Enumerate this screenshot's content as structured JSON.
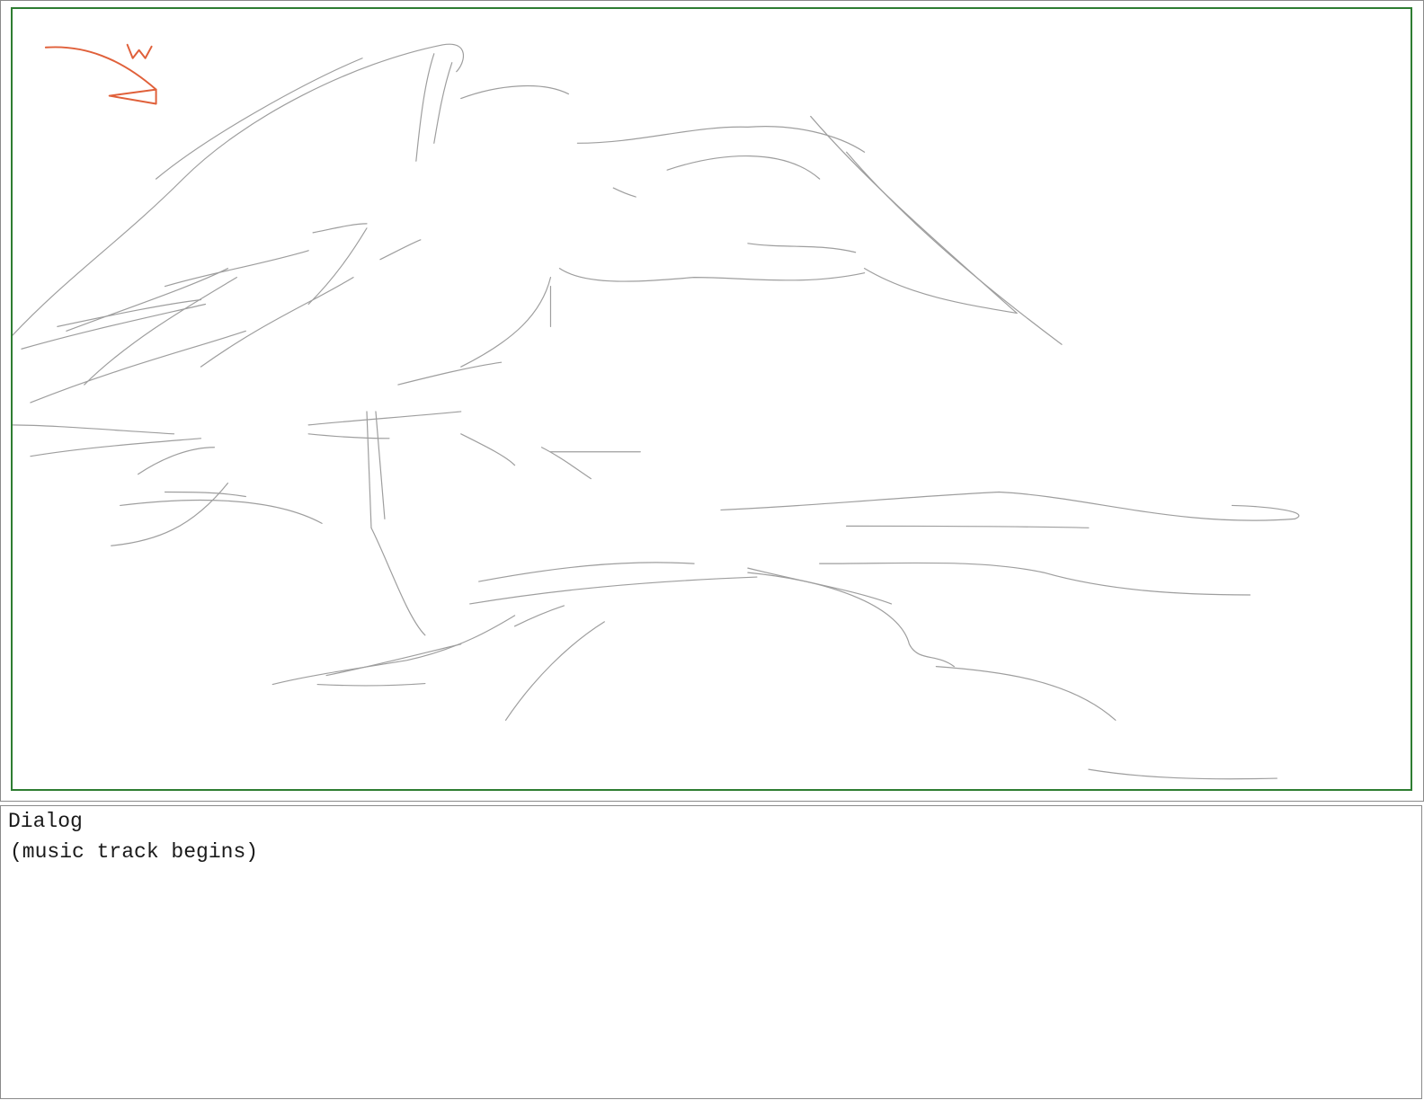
{
  "panel": {
    "frame_color": "#2e7d32",
    "sketch_line_color": "#9e9e9e",
    "annotation_color": "#e0603a",
    "annotation_mark": "W"
  },
  "dialog": {
    "heading": "Dialog",
    "text": "(music track begins)"
  }
}
